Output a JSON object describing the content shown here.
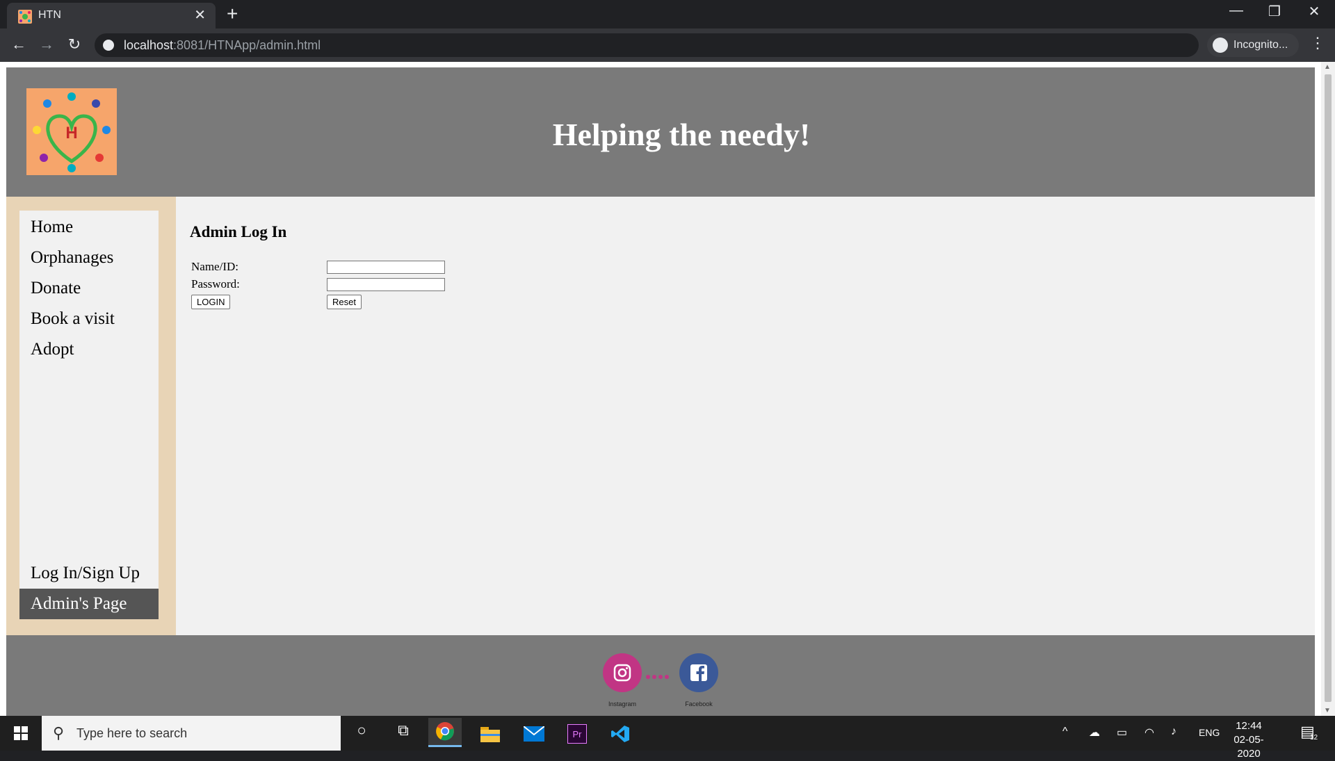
{
  "browser": {
    "tab_title": "HTN",
    "url_host": "localhost",
    "url_path": ":8081/HTNApp/admin.html",
    "profile_label": "Incognito..."
  },
  "header": {
    "title": "Helping the needy!"
  },
  "sidebar": {
    "items": [
      {
        "label": "Home"
      },
      {
        "label": "Orphanages"
      },
      {
        "label": "Donate"
      },
      {
        "label": "Book a visit"
      },
      {
        "label": "Adopt"
      },
      {
        "label": "Log In/Sign Up"
      },
      {
        "label": "Admin's Page"
      }
    ],
    "active_item": "Admin's Page"
  },
  "form": {
    "title": "Admin Log In",
    "name_label": "Name/ID:",
    "name_value": "",
    "password_label": "Password:",
    "password_value": "",
    "login_button": "LOGIN",
    "reset_button": "Reset"
  },
  "footer": {
    "instagram_label": "Instagram",
    "facebook_label": "Facebook"
  },
  "taskbar": {
    "search_placeholder": "Type here to search",
    "language": "ENG",
    "time": "12:44",
    "date": "02-05-2020",
    "notification_count": "12"
  },
  "colors": {
    "header_bg": "#7a7a7a",
    "sidebar_bg": "#e8d4b6",
    "active_nav_bg": "#555555",
    "instagram": "#c13584",
    "facebook": "#3b5998"
  }
}
